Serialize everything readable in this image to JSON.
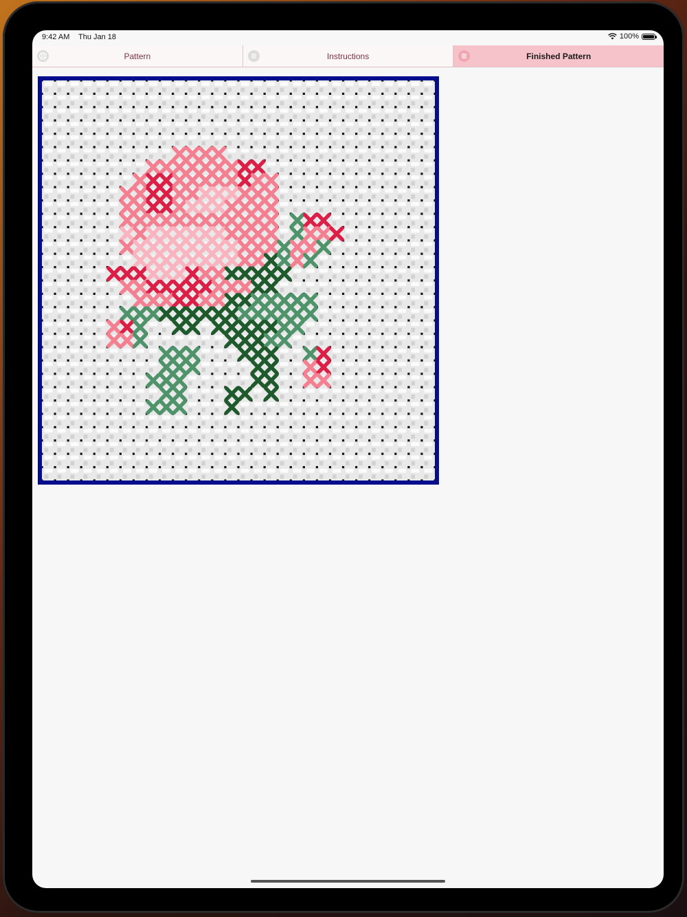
{
  "status_bar": {
    "time": "9:42 AM",
    "date": "Thu Jan 18",
    "battery": "100%"
  },
  "tabs": [
    {
      "label": "Pattern",
      "icon": "grid-icon",
      "active": false
    },
    {
      "label": "Instructions",
      "icon": "list-icon",
      "active": false
    },
    {
      "label": "Finished Pattern",
      "icon": "list-icon",
      "active": true
    }
  ],
  "colors": {
    "accent_tab": "#f6c3ca",
    "frame_border": "#060d8c",
    "fabric": "#e9e9e9",
    "hole": "#111111",
    "thread": {
      "P": "#f47f90",
      "L": "#f9b4bf",
      "R": "#dc1f47",
      "G": "#4f936a",
      "D": "#1f5a2c"
    }
  },
  "finished_pattern": {
    "grid_size": [
      30,
      30
    ],
    "rows": [
      "..............................",
      "..............................",
      "..............................",
      "..............................",
      "..............................",
      "..........PPPP................",
      "........PPPPPPPRR.............",
      ".......PRRPPPPPRPP............",
      "......PPRRPPLLLPPP............",
      "......PPRRPLLLPPPP............",
      "......PPPPPPPPPPPP.GRR........",
      "......LPLLLLLLPPPP.GPPR.......",
      "......PLLLLLLLLPPPGPPG........",
      ".......LLLLLLLLPPDGPG.........",
      ".....RRRLLLRPPDDDDD...........",
      "......PPRRRRRPPPDD............",
      ".......PPPRRPPDDGGGGG.........",
      "......GGGDDDDDDGGGGGG.........",
      ".....PRG..DD.DDDDDGG..........",
      ".....PPG......DDDGG...........",
      ".........GGG...DDD..GR........",
      ".........GGG....DD..PR........",
      "........GGG.....DD..PP........",
      ".........GG...DD.D............",
      "........GGG...D...............",
      "..............................",
      "..............................",
      "..............................",
      "..............................",
      ".............................."
    ]
  }
}
